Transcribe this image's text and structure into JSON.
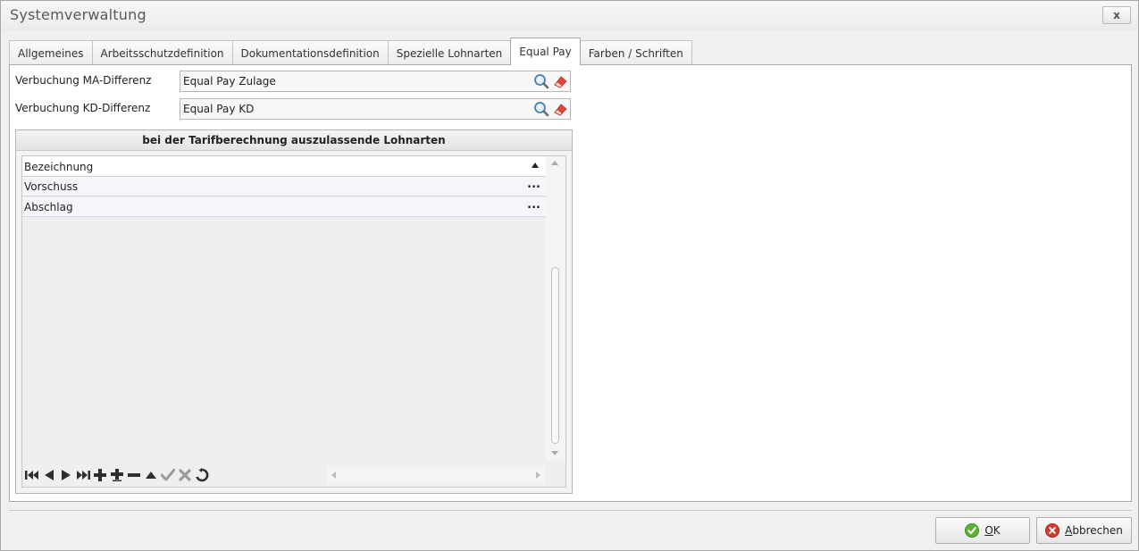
{
  "window": {
    "title": "Systemverwaltung",
    "close_label": "x"
  },
  "tabs": [
    {
      "label": "Allgemeines",
      "active": false
    },
    {
      "label": "Arbeitsschutzdefinition",
      "active": false
    },
    {
      "label": "Dokumentationsdefinition",
      "active": false
    },
    {
      "label": "Spezielle Lohnarten",
      "active": false
    },
    {
      "label": "Equal Pay",
      "active": true
    },
    {
      "label": "Farben / Schriften",
      "active": false
    }
  ],
  "fields": {
    "ma": {
      "label": "Verbuchung MA-Differenz",
      "value": "Equal Pay Zulage"
    },
    "kd": {
      "label": "Verbuchung KD-Differenz",
      "value": "Equal Pay KD"
    }
  },
  "group": {
    "title": "bei der Tarifberechnung auszulassende Lohnarten",
    "column": "Bezeichnung",
    "rows": [
      {
        "name": "Vorschuss",
        "action": "..."
      },
      {
        "name": "Abschlag",
        "action": "..."
      }
    ]
  },
  "navigator": {
    "icons": [
      "first-icon",
      "prev-icon",
      "next-icon",
      "last-icon",
      "append-icon",
      "insert-icon",
      "delete-icon",
      "edit-icon",
      "post-icon",
      "cancel-edit-icon",
      "refresh-icon"
    ]
  },
  "buttons": {
    "ok": {
      "accel": "O",
      "rest": "K"
    },
    "cancel": {
      "accel": "A",
      "rest": "bbrechen"
    }
  },
  "colors": {
    "ok_icon": "#5cb531",
    "cancel_icon": "#d23c2c",
    "nav_icon": "#2f2f2f",
    "nav_disabled": "#9a9a9a"
  }
}
